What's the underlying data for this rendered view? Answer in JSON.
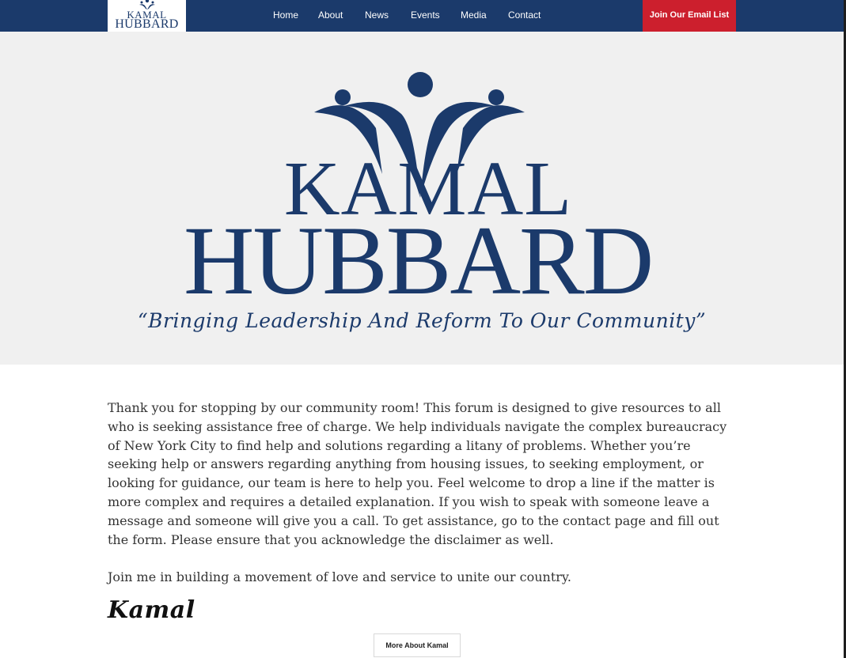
{
  "brand": {
    "logo_line1": "KAMAL",
    "logo_line2": "HUBBARD",
    "primary_color": "#1b3a6b",
    "accent_color": "#cc1f2d"
  },
  "nav": {
    "items": [
      {
        "label": "Home"
      },
      {
        "label": "About"
      },
      {
        "label": "News"
      },
      {
        "label": "Events"
      },
      {
        "label": "Media"
      },
      {
        "label": "Contact"
      }
    ],
    "cta_label": "Join Our Email List"
  },
  "hero": {
    "name_line1": "KAMAL",
    "name_line2": "HUBBARD",
    "tagline": "“Bringing Leadership And Reform To Our Community”"
  },
  "main": {
    "intro_paragraph": "Thank you for stopping by our community room! This forum is designed to give resources to all who is seeking assistance free of charge. We help individuals navigate the complex bureaucracy of New York City to find help and solutions regarding a litany of problems. Whether you’re seeking help or answers regarding anything from housing issues, to seeking employment, or looking for guidance, our team is here to help you. Feel welcome to drop a line if the matter is more complex and requires a detailed explanation. If you wish to speak with someone leave a message and someone will give you a call. To get assistance, go to the contact page and fill out the form. Please ensure that you acknowledge the disclaimer as well.",
    "closing_paragraph": "Join me in building a movement of love and service to unite our country.",
    "signature": "Kamal",
    "more_button_label": "More About Kamal"
  }
}
